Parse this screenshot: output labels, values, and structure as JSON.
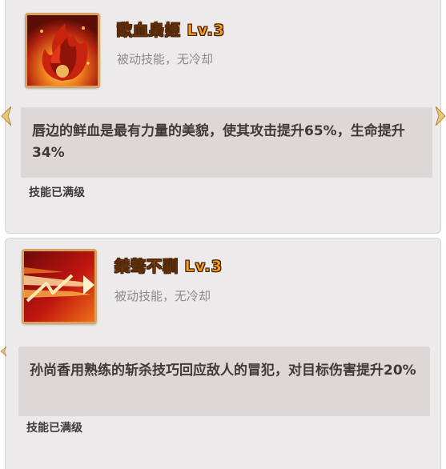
{
  "skills": [
    {
      "icon": "blood-flame-icon",
      "title": "歃血枭姬 Lv.3",
      "type": "被动技能，无冷却",
      "description": "唇边的鲜血是最有力量的美貌，使其攻击提升65%，生命提升34%",
      "status": "技能已满级"
    },
    {
      "icon": "slash-strike-icon",
      "title": "桀骜不驯 Lv.3",
      "type": "被动技能，无冷却",
      "description": "孙尚香用熟练的斩杀技巧回应敌人的冒犯，对目标伤害提升20%",
      "status": "技能已满级"
    }
  ],
  "colors": {
    "title": "#f6a21c",
    "panel_bg": "#eceaea",
    "desc_bg": "#dcd8d7",
    "frame": "#d7a35e"
  }
}
